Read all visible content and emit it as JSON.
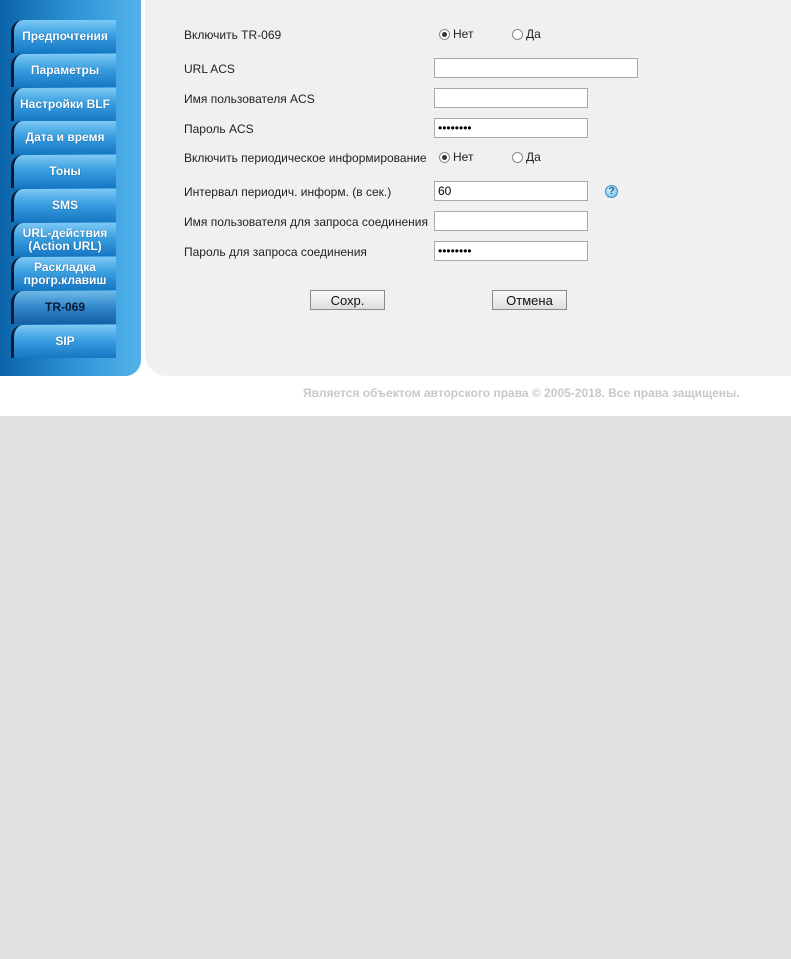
{
  "sidebar": {
    "items": [
      {
        "label": "Предпочтения"
      },
      {
        "label": "Параметры"
      },
      {
        "label": "Настройки BLF"
      },
      {
        "label": "Дата и время"
      },
      {
        "label": "Тоны"
      },
      {
        "label": "SMS"
      },
      {
        "label": "URL-действия\n(Action URL)"
      },
      {
        "label": "Раскладка\nпрогр.клавиш"
      },
      {
        "label": "TR-069"
      },
      {
        "label": "SIP"
      }
    ],
    "active": "TR-069"
  },
  "form": {
    "enable_tr069": {
      "label": "Включить TR-069",
      "options": [
        "Нет",
        "Да"
      ],
      "selected": "Нет"
    },
    "acs_url": {
      "label": "URL ACS",
      "value": ""
    },
    "acs_user": {
      "label": "Имя пользователя ACS",
      "value": ""
    },
    "acs_password": {
      "label": "Пароль ACS",
      "value": "********"
    },
    "periodic_inform": {
      "label": "Включить периодическое информирование",
      "options": [
        "Нет",
        "Да"
      ],
      "selected": "Нет"
    },
    "inform_interval": {
      "label": "Интервал периодич. информ. (в сек.)",
      "value": "60",
      "help_icon": "help-icon"
    },
    "conn_req_user": {
      "label": "Имя пользователя для запроса соединения",
      "value": ""
    },
    "conn_req_password": {
      "label": "Пароль для запроса соединения",
      "value": "********"
    }
  },
  "buttons": {
    "save": "Сохр.",
    "cancel": "Отмена"
  },
  "footer": {
    "copyright": "Является объектом авторского права © 2005-2018. Все права защищены."
  },
  "colors": {
    "sidebar": "#2e95d8",
    "content_bg": "#f0f0f0",
    "page_bg": "#e1e1e1"
  }
}
